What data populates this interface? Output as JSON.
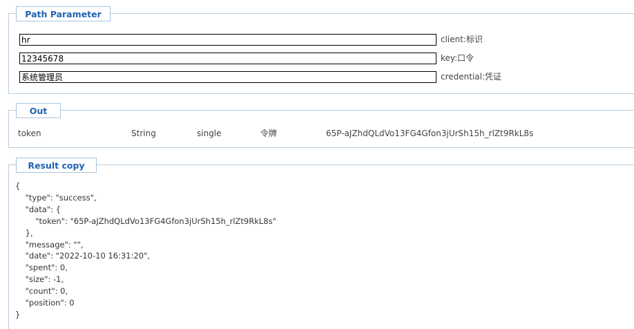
{
  "path_parameter": {
    "title": "Path Parameter",
    "fields": [
      {
        "value": "hr",
        "hint": "client:标识"
      },
      {
        "value": "12345678",
        "hint": "key:口令"
      },
      {
        "value": "系统管理员",
        "hint": "credential:凭证"
      }
    ]
  },
  "out": {
    "title": "Out",
    "row": {
      "name": "token",
      "type": "String",
      "mode": "single",
      "description": "令牌",
      "value": "65P-aJZhdQLdVo13FG4Gfon3jUrSh15h_rlZt9RkL8s"
    }
  },
  "result_copy": {
    "title": "Result copy",
    "json_text": "{\n    \"type\": \"success\",\n    \"data\": {\n        \"token\": \"65P-aJZhdQLdVo13FG4Gfon3jUrSh15h_rlZt9RkL8s\"\n    },\n    \"message\": \"\",\n    \"date\": \"2022-10-10 16:31:20\",\n    \"spent\": 0,\n    \"size\": -1,\n    \"count\": 0,\n    \"position\": 0\n}"
  }
}
